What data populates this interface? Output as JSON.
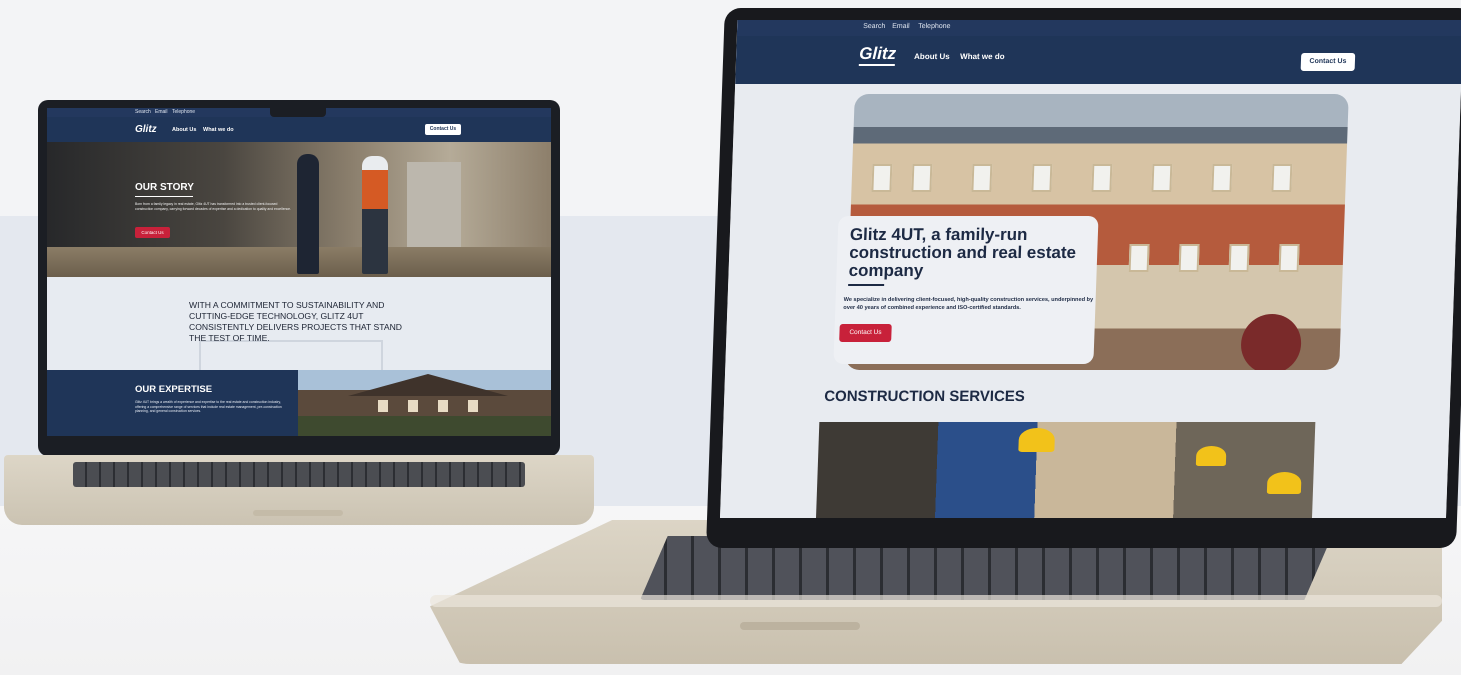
{
  "small_site": {
    "topbar": [
      "Search",
      "Email",
      "Telephone"
    ],
    "logo": "Glitz",
    "nav": [
      "About Us",
      "What we do"
    ],
    "contact_button": "Contact Us",
    "story": {
      "title": "OUR STORY",
      "text": "Born from a family legacy in real estate, Glitz 4UT has transformed into a trusted client-focused construction company, carrying forward decades of expertise and a dedication to quality and excellence.",
      "button": "Contact Us"
    },
    "commitment": "WITH A COMMITMENT TO SUSTAINABILITY AND CUTTING-EDGE TECHNOLOGY, GLITZ 4UT CONSISTENTLY DELIVERS PROJECTS THAT STAND THE TEST OF TIME.",
    "expertise": {
      "title": "OUR EXPERTISE",
      "text": "Glitz 4UT brings a wealth of experience and expertise to the real estate and construction industry, offering a comprehensive range of services that include real estate management, pre-construction planning, and general construction services."
    }
  },
  "large_site": {
    "topbar": [
      "Search",
      "Email",
      "Telephone"
    ],
    "logo": "Glitz",
    "nav": [
      "About Us",
      "What we do"
    ],
    "contact_button": "Contact Us",
    "hero": {
      "title": "Glitz 4UT, a family-run construction and real estate company",
      "text": "We specialize in delivering client-focused, high-quality construction services, underpinned by over 40 years of combined experience and ISO-certified standards.",
      "button": "Contact Us"
    },
    "services_title": "CONSTRUCTION SERVICES"
  },
  "colors": {
    "navy": "#1f3558",
    "accent_red": "#c8213a",
    "laptop_silver": "#d6cfbf"
  }
}
